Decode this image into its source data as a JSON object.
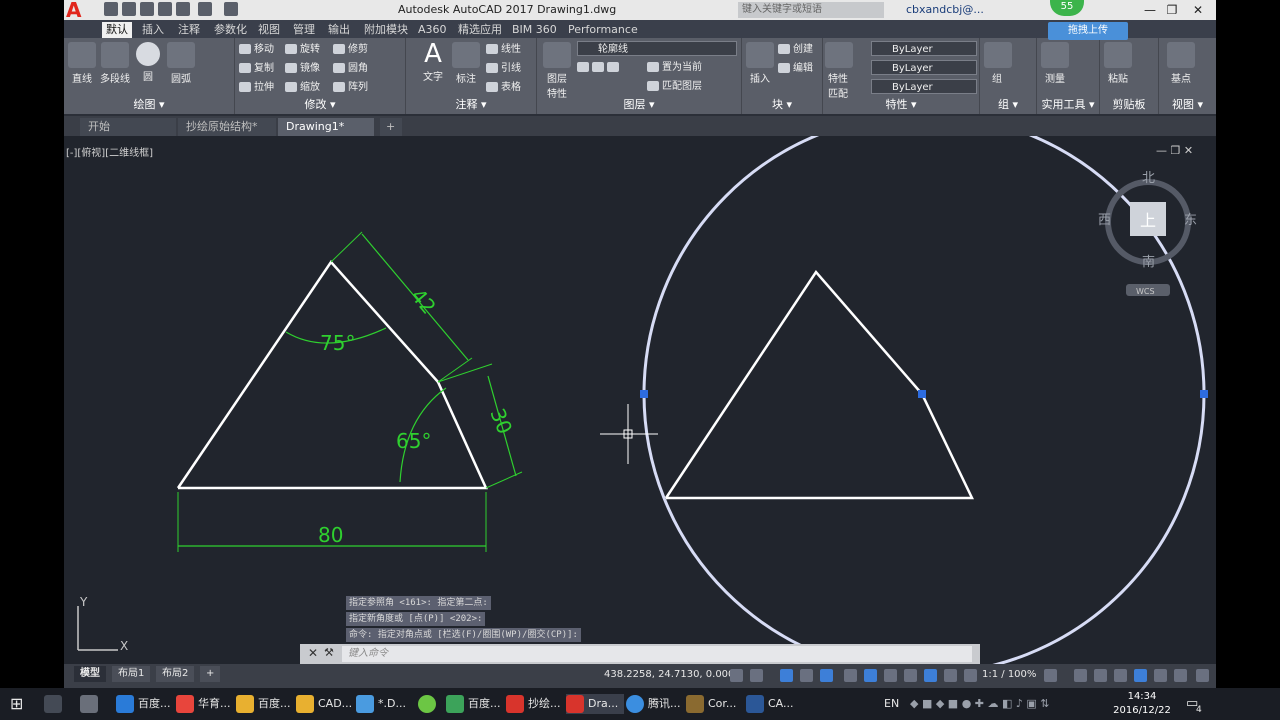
{
  "app": {
    "title": "Autodesk AutoCAD 2017    Drawing1.dwg",
    "search_placeholder": "键入关键字或短语",
    "user": "cbxandcbj@...",
    "logo": "A"
  },
  "overlay": {
    "badge": "55",
    "upload_label": "拖拽上传"
  },
  "ribbon_tabs": [
    "默认",
    "插入",
    "注释",
    "参数化",
    "视图",
    "管理",
    "输出",
    "附加模块",
    "A360",
    "精选应用",
    "BIM 360",
    "Performance"
  ],
  "panels": {
    "draw": {
      "label": "绘图 ▾",
      "tools": [
        "直线",
        "多段线",
        "圆",
        "圆弧"
      ]
    },
    "modify": {
      "label": "修改 ▾",
      "rows": [
        "移动",
        "旋转",
        "修剪",
        "复制",
        "镜像",
        "圆角",
        "拉伸",
        "缩放",
        "阵列"
      ]
    },
    "annotation": {
      "label": "注释 ▾",
      "tools": [
        "文字",
        "标注"
      ],
      "rows": [
        "线性",
        "引线",
        "表格"
      ]
    },
    "layers": {
      "label": "图层 ▾",
      "tool": "图层\n特性",
      "layer_name": "轮廓线",
      "rows": [
        "置为当前",
        "匹配图层"
      ]
    },
    "block": {
      "label": "块 ▾",
      "tool": "插入",
      "rows": [
        "创建",
        "编辑"
      ]
    },
    "properties": {
      "label": "特性 ▾",
      "tool": "特性\n匹配",
      "values": [
        "ByLayer",
        "ByLayer",
        "ByLayer"
      ]
    },
    "group": {
      "label": "组 ▾",
      "tool": "组"
    },
    "utilities": {
      "label": "实用工具 ▾",
      "tool": "测量"
    },
    "clipboard": {
      "label": "剪贴板",
      "tool": "粘贴"
    },
    "view": {
      "label": "视图 ▾",
      "tool": "基点"
    }
  },
  "doc_tabs": [
    "开始",
    "抄绘原始结构*",
    "Drawing1*"
  ],
  "viewport": {
    "label": "[-][俯视][二维线框]",
    "dims": {
      "top_side": "42",
      "angle_top": "75°",
      "right_side": "30",
      "angle_right": "65°",
      "base": "80"
    },
    "viewcube": {
      "north": "北",
      "south": "南",
      "west": "西",
      "east": "东",
      "face": "上",
      "wcs": "WCS"
    },
    "ucs": {
      "x": "X",
      "y": "Y"
    }
  },
  "command": {
    "history": [
      "指定参照角 <161>:  指定第二点:",
      "指定新角度或 [点(P)] <202>:",
      "命令: 指定对角点或 [栏选(F)/圈围(WP)/圈交(CP)]:"
    ],
    "placeholder": "键入命令"
  },
  "status": {
    "layout_tabs": [
      "模型",
      "布局1",
      "布局2"
    ],
    "coords": "438.2258, 24.7130, 0.0000",
    "scale": "1:1 / 100%"
  },
  "taskbar": {
    "items": [
      "百度...",
      "华育...",
      "百度...",
      "CAD...",
      "*.D...",
      "",
      "百度...",
      "抄绘...",
      "Dra...",
      "腾讯...",
      "Cor...",
      "CA..."
    ],
    "lang": "EN",
    "time": "14:34",
    "date": "2016/12/22",
    "notif": "4"
  },
  "colors": {
    "accent": "#e1261c",
    "dim": "#2fd02f",
    "geometry": "#ffffff",
    "circle": "#d7dcf5",
    "grip": "#2d6cdf"
  }
}
